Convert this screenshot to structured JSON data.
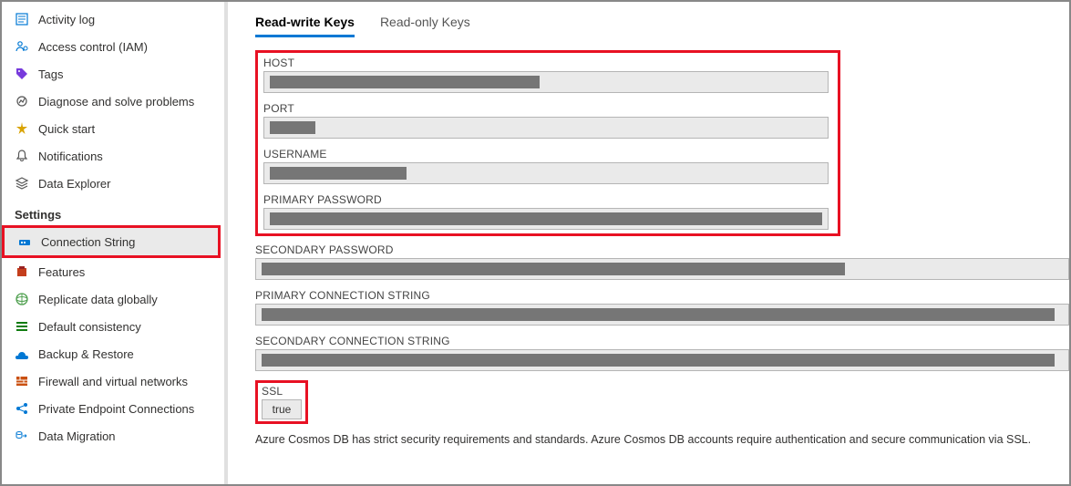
{
  "sidebar": {
    "items_top": [
      {
        "label": "Activity log",
        "icon": "activity-log-icon",
        "color": "#0078d4"
      },
      {
        "label": "Access control (IAM)",
        "icon": "access-control-icon",
        "color": "#0078d4"
      },
      {
        "label": "Tags",
        "icon": "tags-icon",
        "color": "#773adc"
      },
      {
        "label": "Diagnose and solve problems",
        "icon": "diagnose-icon",
        "color": "#555"
      },
      {
        "label": "Quick start",
        "icon": "quick-start-icon",
        "color": "#9b6a00"
      },
      {
        "label": "Notifications",
        "icon": "notifications-icon",
        "color": "#555"
      },
      {
        "label": "Data Explorer",
        "icon": "data-explorer-icon",
        "color": "#555"
      }
    ],
    "settings_header": "Settings",
    "items_settings": [
      {
        "label": "Connection String",
        "icon": "connection-string-icon",
        "color": "#0078d4",
        "selected": true,
        "highlighted": true
      },
      {
        "label": "Features",
        "icon": "features-icon",
        "color": "#c43e1c"
      },
      {
        "label": "Replicate data globally",
        "icon": "replicate-icon",
        "color": "#50a050"
      },
      {
        "label": "Default consistency",
        "icon": "consistency-icon",
        "color": "#107c10"
      },
      {
        "label": "Backup & Restore",
        "icon": "backup-icon",
        "color": "#0078d4"
      },
      {
        "label": "Firewall and virtual networks",
        "icon": "firewall-icon",
        "color": "#ca5010"
      },
      {
        "label": "Private Endpoint Connections",
        "icon": "private-endpoint-icon",
        "color": "#0078d4"
      },
      {
        "label": "Data Migration",
        "icon": "data-migration-icon",
        "color": "#0078d4"
      }
    ]
  },
  "main": {
    "tabs": [
      {
        "label": "Read-write Keys",
        "active": true
      },
      {
        "label": "Read-only Keys",
        "active": false
      }
    ],
    "highlighted_fields": [
      {
        "label": "HOST",
        "redact_width": 296
      },
      {
        "label": "PORT",
        "redact_width": 50
      },
      {
        "label": "USERNAME",
        "redact_width": 150
      },
      {
        "label": "PRIMARY PASSWORD",
        "redact_width": 616
      }
    ],
    "other_fields": [
      {
        "label": "SECONDARY PASSWORD",
        "redact_width": 640
      },
      {
        "label": "PRIMARY CONNECTION STRING",
        "redact_width": 870
      },
      {
        "label": "SECONDARY CONNECTION STRING",
        "redact_width": 870
      }
    ],
    "ssl": {
      "label": "SSL",
      "value": "true"
    },
    "footer": "Azure Cosmos DB has strict security requirements and standards. Azure Cosmos DB accounts require authentication and secure communication via SSL."
  }
}
